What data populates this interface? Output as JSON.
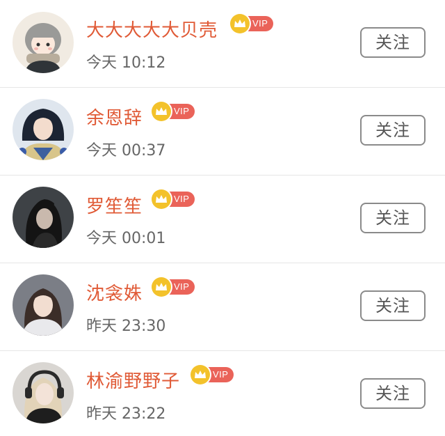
{
  "follow_list": {
    "items": [
      {
        "name": "大大大大大贝壳",
        "vip_label": "VIP",
        "time": "今天 10:12",
        "follow_label": "关注",
        "avatar": "avatar-cartoon-girl-scarf"
      },
      {
        "name": "余恩辞",
        "vip_label": "VIP",
        "time": "今天 00:37",
        "follow_label": "关注",
        "avatar": "avatar-woman-blue-hair"
      },
      {
        "name": "罗笙笙",
        "vip_label": "VIP",
        "time": "今天 00:01",
        "follow_label": "关注",
        "avatar": "avatar-woman-dark-hair"
      },
      {
        "name": "沈衾姝",
        "vip_label": "VIP",
        "time": "昨天 23:30",
        "follow_label": "关注",
        "avatar": "avatar-woman-long-hair"
      },
      {
        "name": "林渝野野子",
        "vip_label": "VIP",
        "time": "昨天 23:22",
        "follow_label": "关注",
        "avatar": "avatar-woman-blonde-headphones"
      }
    ]
  },
  "colors": {
    "name": "#e05a36",
    "vip_tag": "#ea6359",
    "crown_badge": "#f3c22b",
    "time_text": "#666666",
    "button_border": "#8a8a8a",
    "divider": "#e6e6e6"
  }
}
